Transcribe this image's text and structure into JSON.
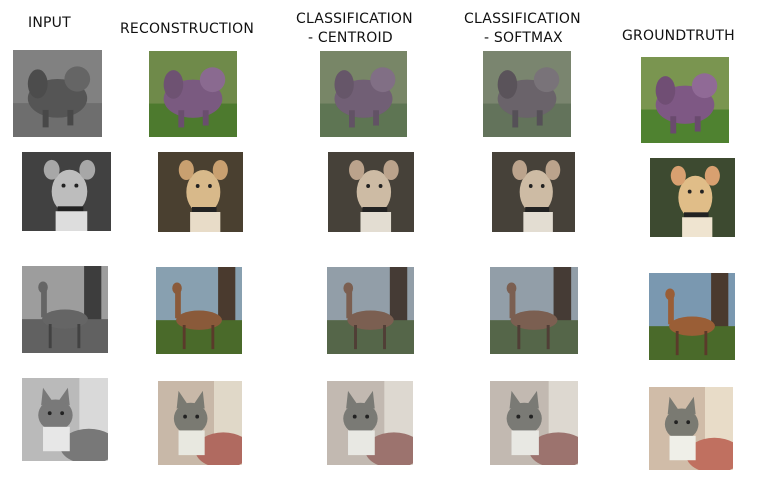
{
  "headers": {
    "input": "INPUT",
    "reconstruction": "RECONSTRUCTION",
    "class_centroid_1": "CLASSIFICATION",
    "class_centroid_2": "- CENTROID",
    "class_softmax_1": "CLASSIFICATION",
    "class_softmax_2": "- SOFTMAX",
    "groundtruth": "GROUNDTRUTH"
  },
  "rows": [
    {
      "subject": "fluffy dog on grass"
    },
    {
      "subject": "dog with collar"
    },
    {
      "subject": "deer by tree"
    },
    {
      "subject": "cat on pillow"
    }
  ],
  "columns": [
    "input",
    "reconstruction",
    "classification-centroid",
    "classification-softmax",
    "groundtruth"
  ]
}
